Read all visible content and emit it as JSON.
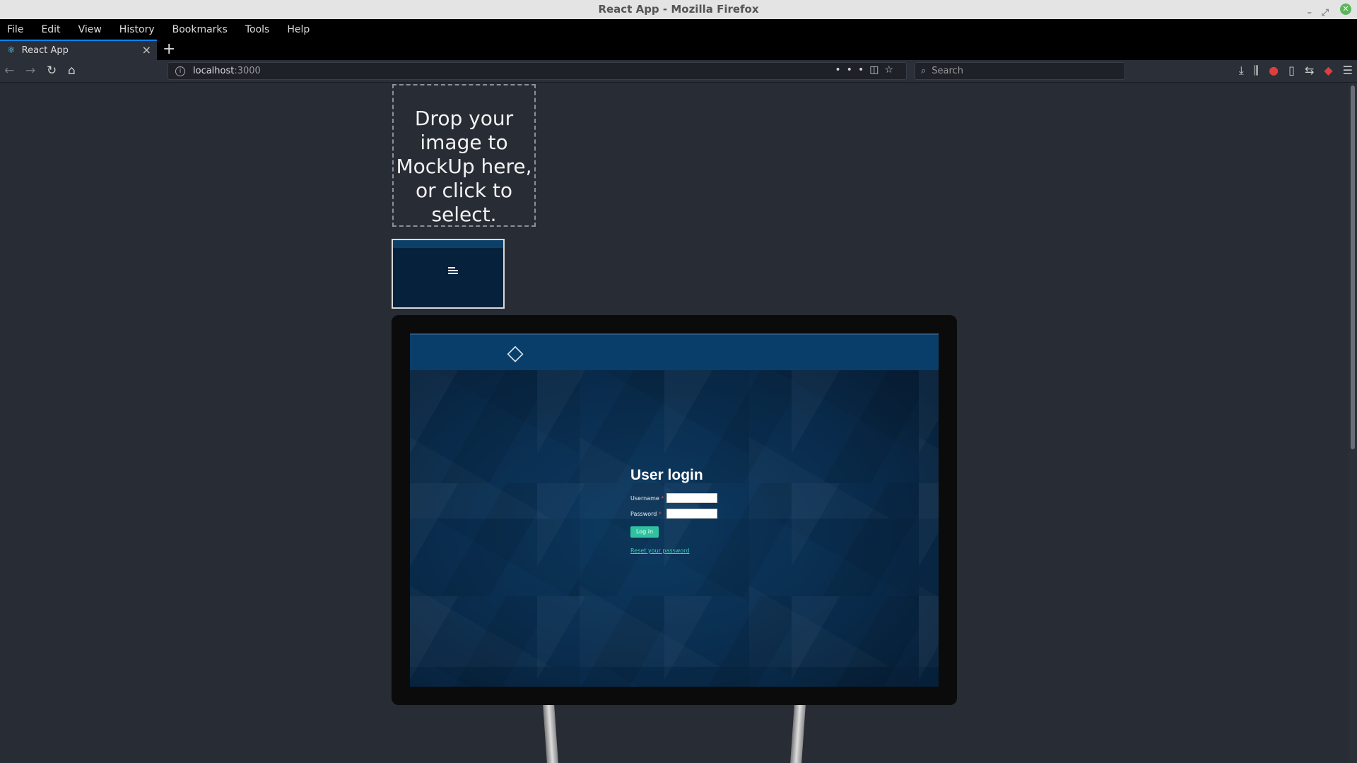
{
  "window": {
    "title": "React App - Mozilla Firefox"
  },
  "menu": [
    "File",
    "Edit",
    "View",
    "History",
    "Bookmarks",
    "Tools",
    "Help"
  ],
  "tab": {
    "title": "React App"
  },
  "url": {
    "host": "localhost",
    "port": ":3000"
  },
  "search": {
    "placeholder": "Search"
  },
  "dropzone": {
    "text": "Drop your image to MockUp here, or click to select."
  },
  "mockup": {
    "title": "User login",
    "username_label": "Username",
    "password_label": "Password",
    "required_mark": "*",
    "login_button": "Log in",
    "reset_link": "Reset your password"
  }
}
